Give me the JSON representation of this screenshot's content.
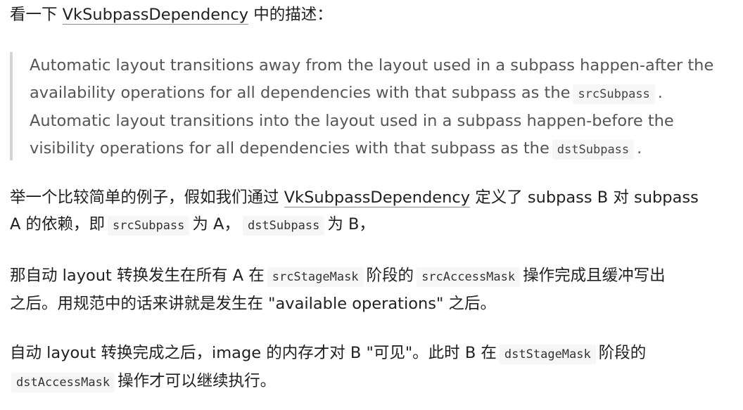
{
  "intro": {
    "prefix": "看一下 ",
    "link": "VkSubpassDependency",
    "suffix": " 中的描述："
  },
  "quote": {
    "line1": "Automatic layout transitions away from the layout used in a subpass happen-after the",
    "line2_pre": "availability operations for all dependencies with that subpass as the",
    "line2_code": "srcSubpass",
    "line2_post": ".",
    "line3": "Automatic layout transitions into the layout used in a subpass happen-before the",
    "line4_pre": "visibility operations for all dependencies with that subpass as the",
    "line4_code": "dstSubpass",
    "line4_post": "."
  },
  "example": {
    "l1_pre": "举一个比较简单的例子，假如我们通过 ",
    "l1_link": "VkSubpassDependency",
    "l1_post": " 定义了 subpass B 对 subpass",
    "l2_pre": "A 的依赖，即",
    "l2_code1": "srcSubpass",
    "l2_mid": "为 A，",
    "l2_code2": "dstSubpass",
    "l2_post": "为 B，"
  },
  "transition": {
    "l1_pre": "那自动 layout 转换发生在所有 A 在",
    "l1_code1": "srcStageMask",
    "l1_mid": "阶段的",
    "l1_code2": "srcAccessMask",
    "l1_post": "操作完成且缓冲写出",
    "l2": "之后。用规范中的话来讲就是发生在 \"available operations\" 之后。"
  },
  "after": {
    "l1_pre": "自动 layout 转换完成之后，image 的内存才对 B \"可见\"。此时 B 在",
    "l1_code": "dstStageMask",
    "l1_post": "阶段的",
    "l2_code": "dstAccessMask",
    "l2_post": "操作才可以继续执行。"
  }
}
